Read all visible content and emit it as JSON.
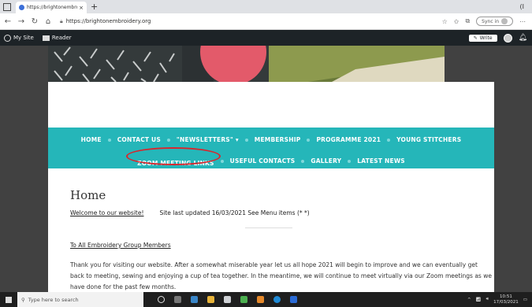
{
  "browser": {
    "tab_title": "https://brightonembroidery.org",
    "tab_close": "×",
    "new_tab": "+",
    "url": "https://brightonembroidery.org",
    "sync_label": "Sync in",
    "window_controls": "(I"
  },
  "wp_admin": {
    "my_site": "My Site",
    "reader": "Reader",
    "write": "Write"
  },
  "menu": {
    "row1": [
      "HOME",
      "CONTACT US",
      "\"NEWSLETTERS\" ▾",
      "MEMBERSHIP",
      "PROGRAMME 2021",
      "YOUNG STITCHERS"
    ],
    "row2": [
      "ZOOM MEETING LINKS",
      "USEFUL CONTACTS",
      "GALLERY",
      "LATEST NEWS"
    ],
    "highlight_color": "#d8262d",
    "bar_color": "#25b6b9"
  },
  "page": {
    "title": "Home",
    "welcome_link": "Welcome to our website!",
    "updated_text": "Site last updated 16/03/2021 See Menu items (* *)",
    "members_link": "To All Embroidery Group Members",
    "paragraph": "Thank you for visiting our website. After a somewhat miserable year let us all hope 2021 will begin to improve and we can eventually get back to meeting, sewing and enjoying a cup of tea together. In the meantime, we will continue to meet virtually via our Zoom meetings as we have done for the past few months."
  },
  "taskbar": {
    "search_placeholder": "Type here to search",
    "time": "10:51",
    "date": "17/03/2021"
  }
}
